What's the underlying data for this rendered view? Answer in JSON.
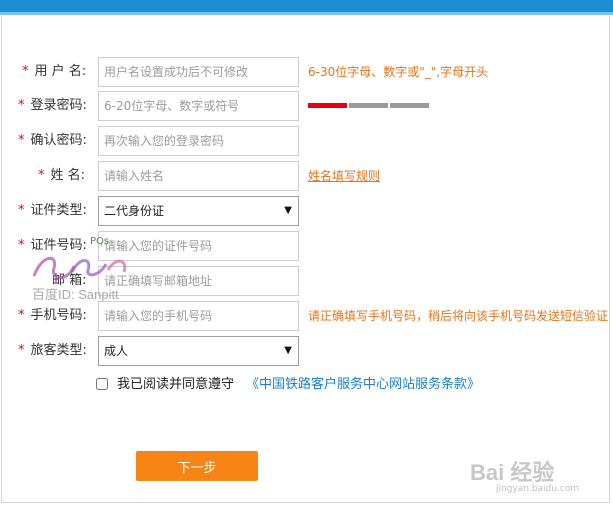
{
  "form": {
    "username": {
      "label": "用 户 名:",
      "placeholder": "用户名设置成功后不可修改",
      "hint": "6-30位字母、数字或\"_\",字母开头"
    },
    "password": {
      "label": "登录密码:",
      "placeholder": "6-20位字母、数字或符号"
    },
    "password_strength": {
      "colors": [
        "#e60012",
        "#9a9a9a",
        "#9a9a9a"
      ]
    },
    "confirm_password": {
      "label": "确认密码:",
      "placeholder": "再次输入您的登录密码"
    },
    "name": {
      "label": "姓  名:",
      "placeholder": "请输入姓名",
      "hint_link": "姓名填写规则"
    },
    "id_type": {
      "label": "证件类型:",
      "selected": "二代身份证"
    },
    "id_number": {
      "label": "证件号码:",
      "placeholder": "请输入您的证件号码"
    },
    "email": {
      "label": "邮  箱:",
      "placeholder": "请正确填写邮箱地址"
    },
    "phone": {
      "label": "手机号码:",
      "placeholder": "请输入您的手机号码",
      "hint": "请正确填写手机号码，稍后将向该手机号码发送短信验证"
    },
    "passenger_type": {
      "label": "旅客类型:",
      "selected": "成人"
    },
    "required_mark": "*",
    "dropdown_arrow": "▼"
  },
  "agreement": {
    "text": "我已阅读并同意遵守",
    "link": "《中国铁路客户服务中心网站服务条款》"
  },
  "actions": {
    "next_label": "下一步"
  },
  "watermark": {
    "id_text": "百度ID: Sanpitt",
    "pq_text": "PQs",
    "baidu_text": "Bai 经验",
    "url_text": "jingyan.baidu.com"
  }
}
